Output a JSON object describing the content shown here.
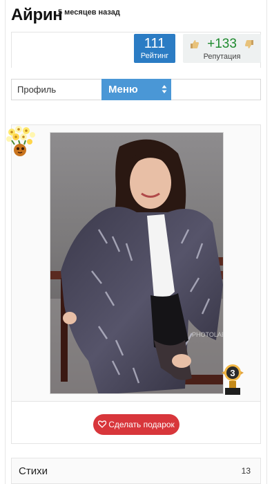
{
  "header": {
    "username": "Айрин",
    "time_ago": "5 месяцев назад"
  },
  "stats": {
    "rating_value": "111",
    "rating_label": "Рейтинг",
    "reputation_value": "+133",
    "reputation_label": "Репутация"
  },
  "nav": {
    "profile_tab": "Профиль",
    "menu_label": "Меню"
  },
  "photo": {
    "award_number": "3"
  },
  "actions": {
    "gift_button": "Сделать подарок"
  },
  "sections": [
    {
      "label": "Стихи",
      "count": "13"
    }
  ],
  "colors": {
    "rating_bg": "#2b7cc4",
    "reputation_text": "#1e8a2e",
    "menu_bg": "#4a97d6",
    "gift_button_bg": "#d8363b"
  }
}
